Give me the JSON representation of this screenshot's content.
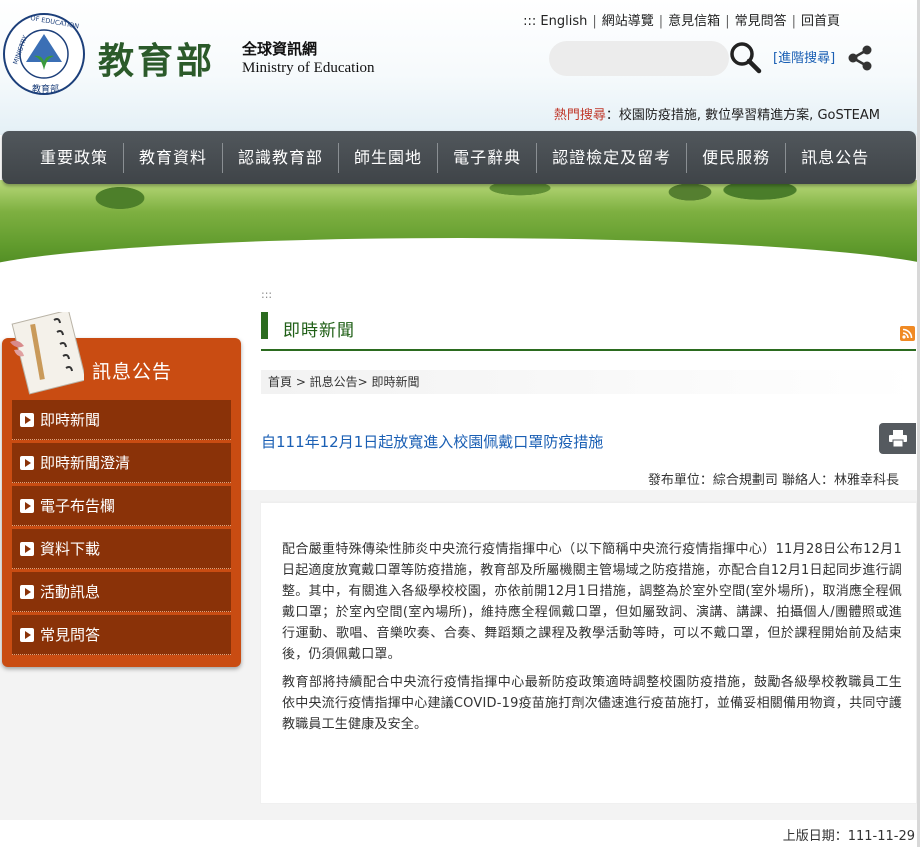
{
  "header": {
    "seal_text": "MINISTRY OF EDUCATION",
    "seal_cn": "教育部",
    "logo_cn": "教育部",
    "logo_net": "全球資訊網",
    "logo_en": "Ministry of Education",
    "top_links": [
      {
        "label": "::: English"
      },
      {
        "label": "網站導覽"
      },
      {
        "label": "意見信箱"
      },
      {
        "label": "常見問答"
      },
      {
        "label": "回首頁"
      }
    ],
    "search_placeholder": "",
    "adv_search": "[進階搜尋]",
    "hot_label": "熱門搜尋",
    "hot_terms": "：校園防疫措施, 數位學習精進方案, GoSTEAM"
  },
  "nav": [
    {
      "label": "重要政策"
    },
    {
      "label": "教育資料"
    },
    {
      "label": "認識教育部"
    },
    {
      "label": "師生園地"
    },
    {
      "label": "電子辭典"
    },
    {
      "label": "認證檢定及留考"
    },
    {
      "label": "便民服務"
    },
    {
      "label": "訊息公告"
    }
  ],
  "sidebar": {
    "title": "訊息公告",
    "items": [
      {
        "label": "即時新聞"
      },
      {
        "label": "即時新聞澄清"
      },
      {
        "label": "電子布告欄"
      },
      {
        "label": "資料下載"
      },
      {
        "label": "活動訊息"
      },
      {
        "label": "常見問答"
      }
    ]
  },
  "main": {
    "dots": ":::",
    "page_title": "即時新聞",
    "breadcrumb": "首頁 > 訊息公告> 即時新聞",
    "article_title": "自111年12月1日起放寬進入校園佩戴口罩防疫措施",
    "publisher": "發布單位：綜合規劃司  聯絡人：林雅幸科長",
    "paragraph1": "配合嚴重特殊傳染性肺炎中央流行疫情指揮中心（以下簡稱中央流行疫情指揮中心）11月28日公布12月1日起適度放寬戴口罩等防疫措施，教育部及所屬機關主管場域之防疫措施，亦配合自12月1日起同步進行調整。其中，有關進入各級學校校園，亦依前開12月1日措施，調整為於室外空間(室外場所)，取消應全程佩戴口罩；於室內空間(室內場所)，維持應全程佩戴口罩，但如屬致詞、演講、講課、拍攝個人/團體照或進行運動、歌唱、音樂吹奏、合奏、舞蹈類之課程及教學活動等時，可以不戴口罩，但於課程開始前及結束後，仍須佩戴口罩。",
    "paragraph2": "教育部將持續配合中央流行疫情指揮中心最新防疫政策適時調整校園防疫措施，鼓勵各級學校教職員工生依中央流行疫情指揮中心建議COVID-19疫苗施打劑次儘速進行疫苗施打，並備妥相關備用物資，共同守護教職員工生健康及安全。",
    "post_date": "上版日期：111-11-29"
  },
  "colors": {
    "nav_bg": "#474c50",
    "sidebar_bg": "#c94c12",
    "sidebar_item_bg": "#8a3208",
    "title_green": "#1f5f16",
    "link_blue": "#1a5fb4",
    "hot_red": "#c0392b"
  }
}
